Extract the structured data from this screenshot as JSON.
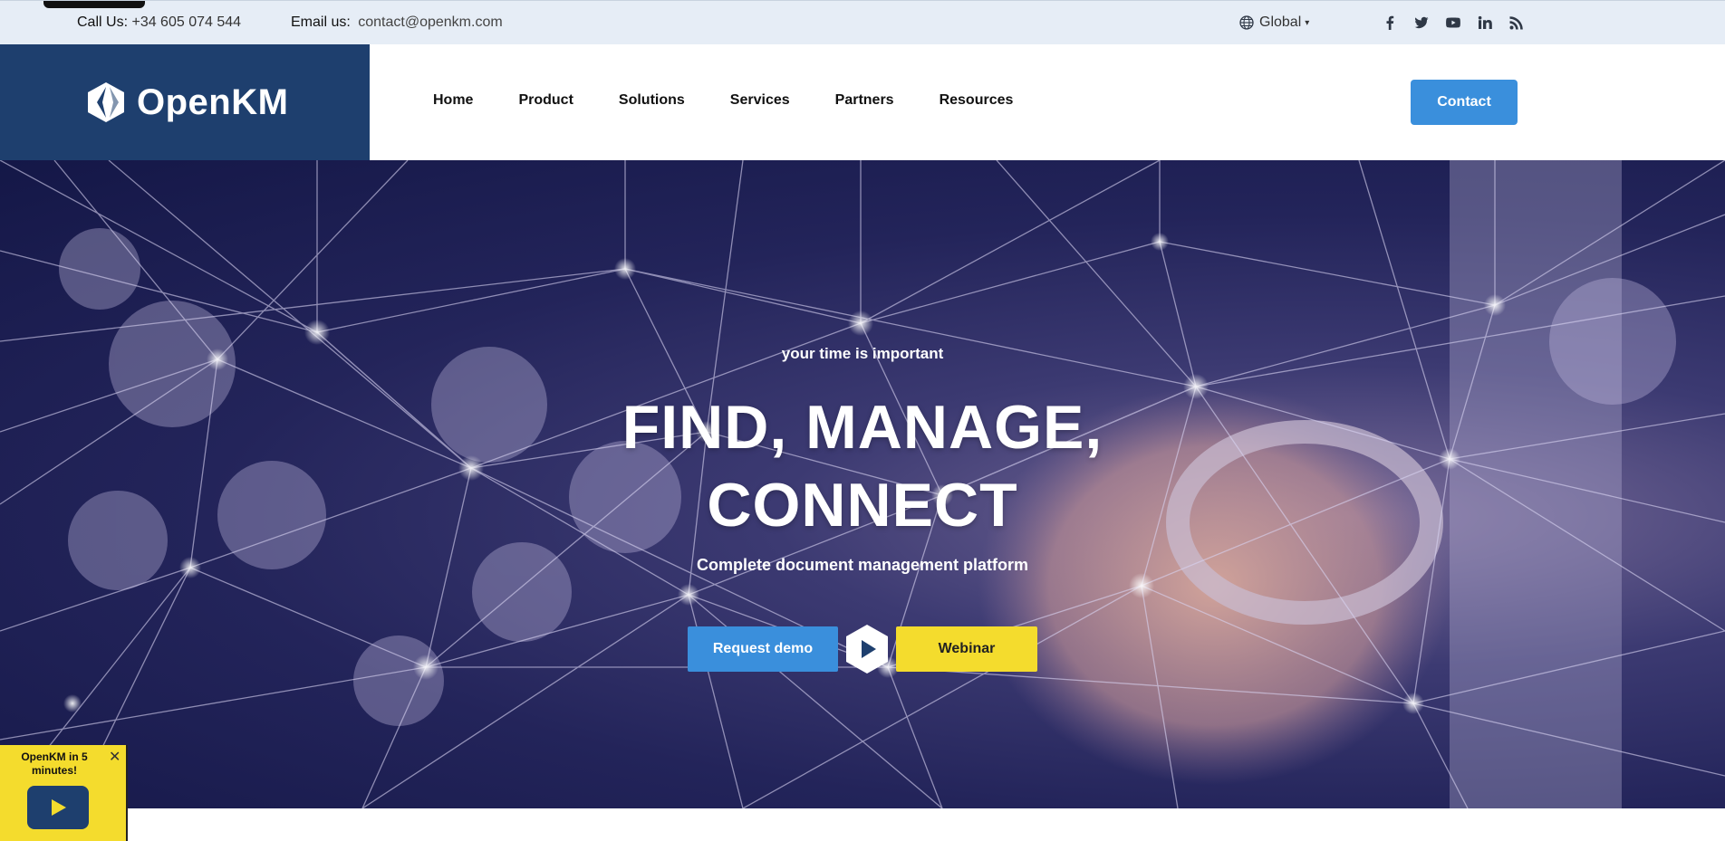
{
  "topbar": {
    "call_label": "Call Us:",
    "call_value": "+34 605 074 544",
    "email_label": "Email us:",
    "email_value": "contact@openkm.com",
    "language": "Global",
    "social": [
      "facebook-icon",
      "twitter-icon",
      "youtube-icon",
      "linkedin-icon",
      "rss-icon"
    ]
  },
  "header": {
    "logo_text": "OpenKM",
    "nav": [
      "Home",
      "Product",
      "Solutions",
      "Services",
      "Partners",
      "Resources"
    ],
    "contact_label": "Contact"
  },
  "hero": {
    "tagline": "your time is important",
    "headline_line1": "FIND, MANAGE,",
    "headline_line2": "CONNECT",
    "subtitle": "Complete document management platform",
    "demo_label": "Request demo",
    "webinar_label": "Webinar"
  },
  "popup": {
    "title": "OpenKM in 5 minutes!",
    "close": "✕"
  },
  "colors": {
    "brand_dark": "#1e3f6e",
    "accent_blue": "#3a8fdc",
    "accent_yellow": "#f4dc2d",
    "topbar_bg": "#e6edf6"
  }
}
